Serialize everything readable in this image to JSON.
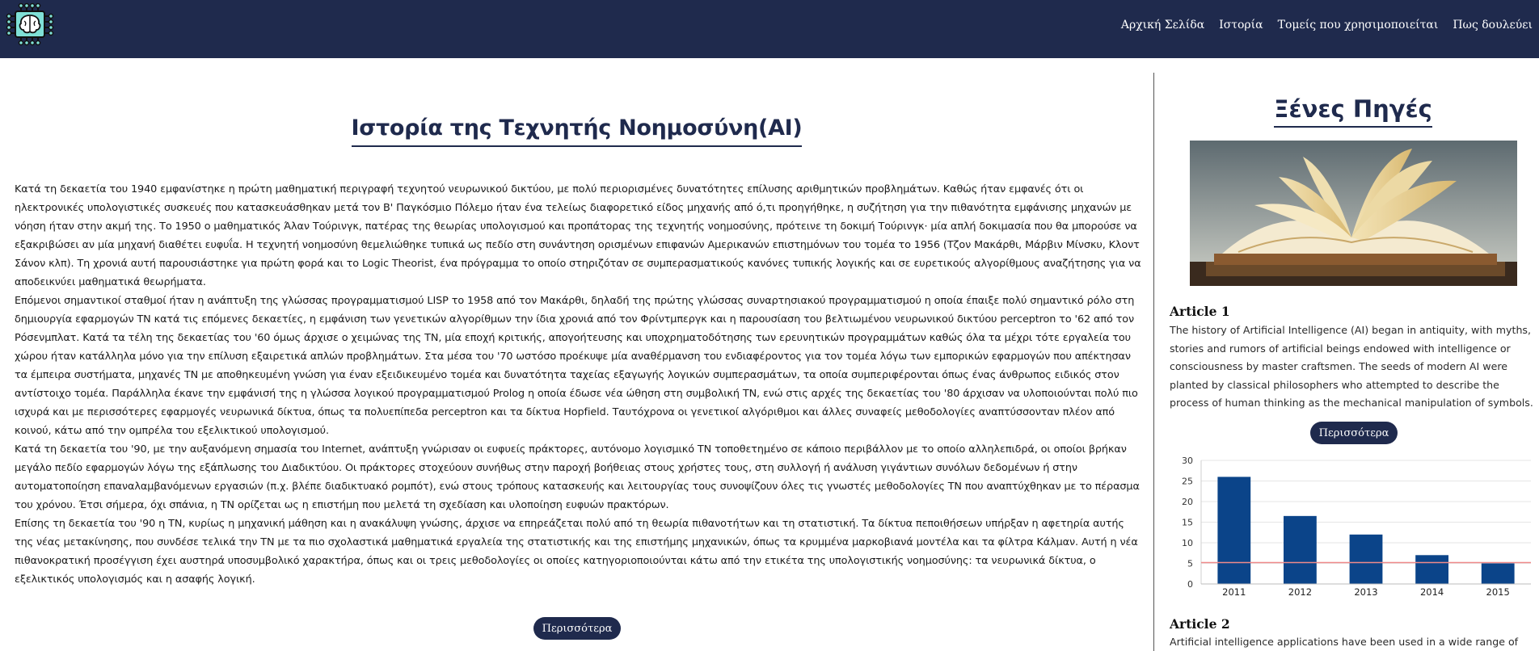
{
  "nav": {
    "logo_alt": "brain chip logo",
    "links": [
      "Αρχική Σελίδα",
      "Ιστορία",
      "Τομείς που χρησιμοποιείται",
      "Πως δουλεύει"
    ]
  },
  "main": {
    "title": "Ιστορία της Τεχνητής Νοημοσύνη(AI)",
    "paragraphs": [
      "Κατά τη δεκαετία του 1940 εμφανίστηκε η πρώτη μαθηματική περιγραφή τεχνητού νευρωνικού δικτύου, με πολύ περιορισμένες δυνατότητες επίλυσης αριθμητικών προβλημάτων. Καθώς ήταν εμφανές ότι οι ηλεκτρονικές υπολογιστικές συσκευές που κατασκευάσθηκαν μετά τον Β' Παγκόσμιο Πόλεμο ήταν ένα τελείως διαφορετικό είδος μηχανής από ό,τι προηγήθηκε, η συζήτηση για την πιθανότητα εμφάνισης μηχανών με νόηση ήταν στην ακμή της. Το 1950 ο μαθηματικός Άλαν Τούρινγκ, πατέρας της θεωρίας υπολογισμού και προπάτορας της τεχνητής νοημοσύνης, πρότεινε τη δοκιμή Τούρινγκ· μία απλή δοκιμασία που θα μπορούσε να εξακριβώσει αν μία μηχανή διαθέτει ευφυΐα. Η τεχνητή νοημοσύνη θεμελιώθηκε τυπικά ως πεδίο στη συνάντηση ορισμένων επιφανών Αμερικανών επιστημόνων του τομέα το 1956 (Τζον Μακάρθι, Μάρβιν Μίνσκυ, Κλοντ Σάνον κλπ). Τη χρονιά αυτή παρουσιάστηκε για πρώτη φορά και το Logic Theorist, ένα πρόγραμμα το οποίο στηριζόταν σε συμπερασματικούς κανόνες τυπικής λογικής και σε ευρετικούς αλγορίθμους αναζήτησης για να αποδεικνύει μαθηματικά θεωρήματα.",
      "Επόμενοι σημαντικοί σταθμοί ήταν η ανάπτυξη της γλώσσας προγραμματισμού LISP το 1958 από τον Μακάρθι, δηλαδή της πρώτης γλώσσας συναρτησιακού προγραμματισμού η οποία έπαιξε πολύ σημαντικό ρόλο στη δημιουργία εφαρμογών ΤΝ κατά τις επόμενες δεκαετίες, η εμφάνιση των γενετικών αλγορίθμων την ίδια χρονιά από τον Φρίντμπεργκ και η παρουσίαση του βελτιωμένου νευρωνικού δικτύου perceptron το '62 από τον Ρόσενμπλατ. Κατά τα τέλη της δεκαετίας του '60 όμως άρχισε ο χειμώνας της ΤΝ, μία εποχή κριτικής, απογοήτευσης και υποχρηματοδότησης των ερευνητικών προγραμμάτων καθώς όλα τα μέχρι τότε εργαλεία του χώρου ήταν κατάλληλα μόνο για την επίλυση εξαιρετικά απλών προβλημάτων. Στα μέσα του '70 ωστόσο προέκυψε μία αναθέρμανση του ενδιαφέροντος για τον τομέα λόγω των εμπορικών εφαρμογών που απέκτησαν τα έμπειρα συστήματα, μηχανές ΤΝ με αποθηκευμένη γνώση για έναν εξειδικευμένο τομέα και δυνατότητα ταχείας εξαγωγής λογικών συμπερασμάτων, τα οποία συμπεριφέρονται όπως ένας άνθρωπος ειδικός στον αντίστοιχο τομέα. Παράλληλα έκανε την εμφάνισή της η γλώσσα λογικού προγραμματισμού Prolog η οποία έδωσε νέα ώθηση στη συμβολική ΤΝ, ενώ στις αρχές της δεκαετίας του '80 άρχισαν να υλοποιούνται πολύ πιο ισχυρά και με περισσότερες εφαρμογές νευρωνικά δίκτυα, όπως τα πολυεπίπεδα perceptron και τα δίκτυα Hopfield. Ταυτόχρονα οι γενετικοί αλγόριθμοι και άλλες συναφείς μεθοδολογίες αναπτύσσονταν πλέον από κοινού, κάτω από την ομπρέλα του εξελικτικού υπολογισμού.",
      "Κατά τη δεκαετία του '90, με την αυξανόμενη σημασία του Internet, ανάπτυξη γνώρισαν οι ευφυείς πράκτορες, αυτόνομο λογισμικό ΤΝ τοποθετημένο σε κάποιο περιβάλλον με το οποίο αλληλεπιδρά, οι οποίοι βρήκαν μεγάλο πεδίο εφαρμογών λόγω της εξάπλωσης του Διαδικτύου. Οι πράκτορες στοχεύουν συνήθως στην παροχή βοήθειας στους χρήστες τους, στη συλλογή ή ανάλυση γιγάντιων συνόλων δεδομένων ή στην αυτοματοποίηση επαναλαμβανόμενων εργασιών (π.χ. βλέπε διαδικτυακό ρομπότ), ενώ στους τρόπους κατασκευής και λειτουργίας τους συνοψίζουν όλες τις γνωστές μεθοδολογίες ΤΝ που αναπτύχθηκαν με το πέρασμα του χρόνου. Έτσι σήμερα, όχι σπάνια, η ΤΝ ορίζεται ως η επιστήμη που μελετά τη σχεδίαση και υλοποίηση ευφυών πρακτόρων.",
      "Επίσης τη δεκαετία του '90 η ΤΝ, κυρίως η μηχανική μάθηση και η ανακάλυψη γνώσης, άρχισε να επηρεάζεται πολύ από τη θεωρία πιθανοτήτων και τη στατιστική. Τα δίκτυα πεποιθήσεων υπήρξαν η αφετηρία αυτής της νέας μετακίνησης, που συνδέσε τελικά την ΤΝ με τα πιο σχολαστικά μαθηματικά εργαλεία της στατιστικής και της επιστήμης μηχανικών, όπως τα κρυμμένα μαρκοβιανά μοντέλα και τα φίλτρα Κάλμαν. Αυτή η νέα πιθανοκρατική προσέγγιση έχει αυστηρά υποσυμβολικό χαρακτήρα, όπως και οι τρεις μεθοδολογίες οι οποίες κατηγοριοποιούνται κάτω από την ετικέτα της υπολογιστικής νοημοσύνης: τα νευρωνικά δίκτυα, ο εξελικτικός υπολογισμός και η ασαφής λογική."
    ],
    "more_label": "Περισσότερα"
  },
  "sidebar": {
    "title": "Ξένες Πηγές",
    "image_alt": "open book",
    "article1": {
      "title": "Article 1",
      "body": "The history of Artificial Intelligence (AI) began in antiquity, with myths, stories and rumors of artificial beings endowed with intelligence or consciousness by master craftsmen. The seeds of modern AI were planted by classical philosophers who attempted to describe the process of human thinking as the mechanical manipulation of symbols.",
      "more_label": "Περισσότερα"
    },
    "article2": {
      "title": "Article 2",
      "body": "Artificial intelligence applications have been used in a wide range of fields"
    }
  },
  "chart_data": {
    "type": "bar",
    "categories": [
      "2011",
      "2012",
      "2013",
      "2014",
      "2015"
    ],
    "values": [
      26,
      16.5,
      12,
      7,
      5
    ],
    "ylim": [
      0,
      30
    ],
    "yticks": [
      "0",
      "5",
      "10",
      "15",
      "20",
      "25",
      "30"
    ],
    "reference_line": 5.2,
    "bar_color": "#0b4489",
    "reference_color": "#f08a8a",
    "grid": true,
    "title": "",
    "xlabel": "",
    "ylabel": ""
  }
}
